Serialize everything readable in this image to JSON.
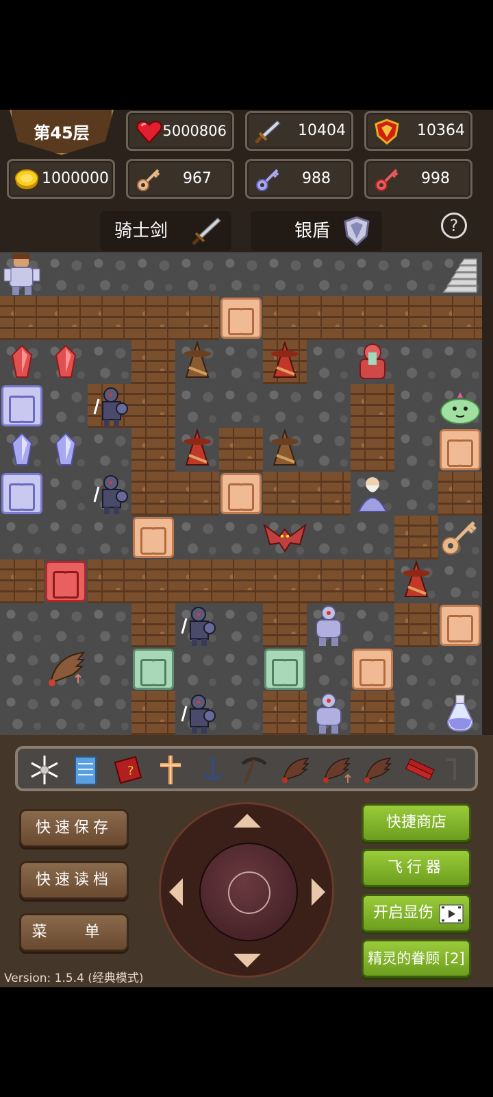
{
  "header": {
    "floor": "第45层",
    "hp": "5000806",
    "attack": "10404",
    "defense": "10364",
    "gold": "1000000",
    "yellow_keys": "967",
    "blue_keys": "988",
    "red_keys": "998"
  },
  "equipment": {
    "weapon": "骑士剑",
    "shield": "银盾",
    "help_label": "?"
  },
  "map": {
    "cols": 11,
    "rows": 11,
    "legend": {
      ".": "floor",
      "W": "wall",
      "y": "door-yellow",
      "b": "door-blue",
      "r": "door-red",
      "g": "door-green"
    },
    "grid": [
      "...........",
      "WWWWWyWWWWW",
      "...W..W....",
      "b.WW....W..",
      "...W.W..W.y",
      "b..WWyWW..W",
      "...y.....W.",
      "WrWWWWWWW..",
      "...W..W..Wy",
      "...g..g.y..",
      "...W..W.W.."
    ],
    "objects": [
      {
        "row": 0,
        "col": 0,
        "type": "hero",
        "name": "hero"
      },
      {
        "row": 0,
        "col": 10,
        "type": "stairs-up",
        "name": "stairs-up"
      },
      {
        "row": 2,
        "col": 0,
        "type": "red-gem",
        "name": "red-gem"
      },
      {
        "row": 2,
        "col": 1,
        "type": "red-gem",
        "name": "red-gem"
      },
      {
        "row": 2,
        "col": 4,
        "type": "brown-wizard",
        "name": "brown-wizard"
      },
      {
        "row": 2,
        "col": 6,
        "type": "red-wizard",
        "name": "red-wizard"
      },
      {
        "row": 2,
        "col": 8,
        "type": "red-guard",
        "name": "red-guard"
      },
      {
        "row": 3,
        "col": 2,
        "type": "dark-knight",
        "name": "dark-knight"
      },
      {
        "row": 3,
        "col": 10,
        "type": "green-slime",
        "name": "green-slime"
      },
      {
        "row": 4,
        "col": 0,
        "type": "blue-gem",
        "name": "blue-gem"
      },
      {
        "row": 4,
        "col": 1,
        "type": "blue-gem",
        "name": "blue-gem"
      },
      {
        "row": 4,
        "col": 4,
        "type": "red-wizard",
        "name": "red-wizard"
      },
      {
        "row": 4,
        "col": 6,
        "type": "brown-wizard",
        "name": "brown-wizard"
      },
      {
        "row": 5,
        "col": 2,
        "type": "dark-knight",
        "name": "dark-knight"
      },
      {
        "row": 5,
        "col": 8,
        "type": "old-sage",
        "name": "old-sage-npc"
      },
      {
        "row": 6,
        "col": 6,
        "type": "red-bat",
        "name": "red-bat"
      },
      {
        "row": 6,
        "col": 10,
        "type": "yellow-key",
        "name": "yellow-key-item"
      },
      {
        "row": 7,
        "col": 9,
        "type": "red-wizard",
        "name": "red-wizard"
      },
      {
        "row": 8,
        "col": 4,
        "type": "dark-knight",
        "name": "dark-knight"
      },
      {
        "row": 8,
        "col": 7,
        "type": "silver-armor",
        "name": "silver-armor-guard"
      },
      {
        "row": 9,
        "col": 1,
        "type": "fly-wing",
        "name": "fly-wing-item"
      },
      {
        "row": 10,
        "col": 4,
        "type": "dark-knight",
        "name": "dark-knight"
      },
      {
        "row": 10,
        "col": 7,
        "type": "silver-armor",
        "name": "silver-armor-guard"
      },
      {
        "row": 10,
        "col": 10,
        "type": "potion",
        "name": "potion-item"
      }
    ]
  },
  "toolbar": {
    "tools": [
      "snowflake-icon",
      "notebook-icon",
      "monster-book-icon",
      "cross-icon",
      "anchor-icon",
      "pickaxe-icon",
      "wing-icon",
      "wing-up-icon",
      "wing-down-icon",
      "dynamite-icon",
      "more-icon"
    ]
  },
  "controls": {
    "quick_save": "快速保存",
    "quick_load": "快速读档",
    "menu": "菜 单",
    "quick_shop": "快捷商店",
    "fly": "飞行器",
    "show_damage": "开启显伤",
    "fairy_favor": "精灵的眷顾 [2]",
    "version": "Version: 1.5.4 (经典模式)"
  },
  "colors": {
    "panel": "#45362a",
    "green_button": "#8bbd2f",
    "brown_button": "#7a5a3c"
  }
}
